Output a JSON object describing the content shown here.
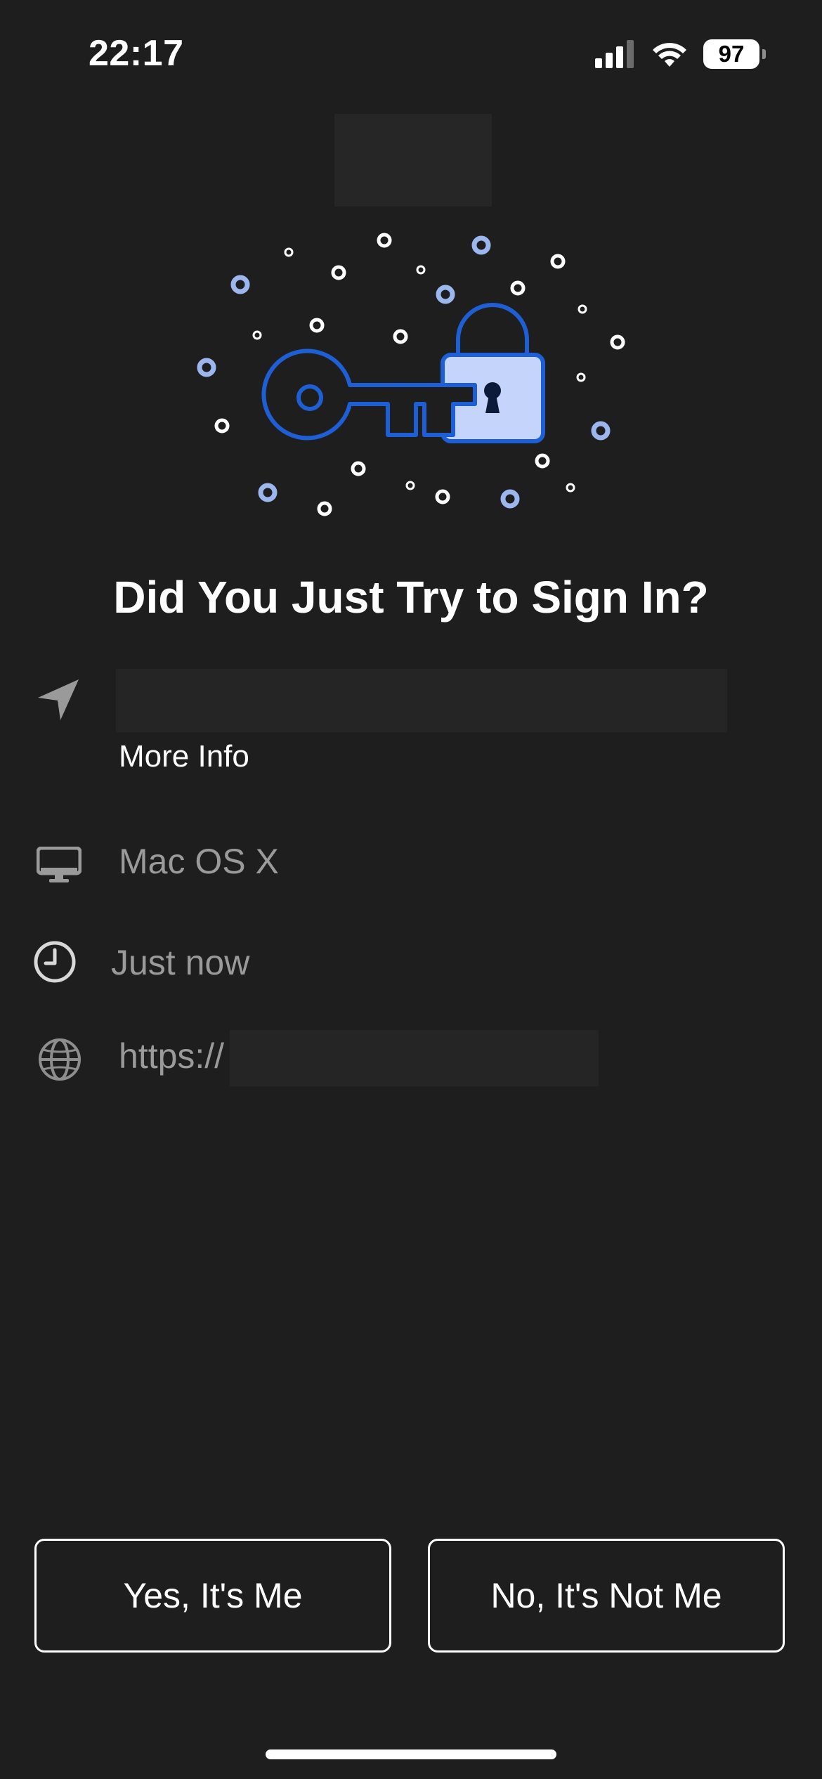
{
  "status_bar": {
    "time": "22:17",
    "battery": "97",
    "signal_icon": "cellular-signal-icon",
    "wifi_icon": "wifi-icon"
  },
  "title": "Did You Just Try to Sign In?",
  "details": {
    "location_icon": "location-arrow-icon",
    "more_info": "More Info",
    "device_icon": "desktop-computer-icon",
    "device": "Mac OS X",
    "time_icon": "clock-icon",
    "time": "Just now",
    "url_icon": "globe-icon",
    "url_prefix": "https://"
  },
  "actions": {
    "yes_label": "Yes, It's Me",
    "no_label": "No, It's Not Me"
  },
  "colors": {
    "background": "#1e1e1e",
    "accent_blue": "#1f5fd6",
    "light_blue": "#c4d4fb",
    "dots_blue": "#9cb6ee",
    "secondary_text": "#9a9a9a"
  }
}
